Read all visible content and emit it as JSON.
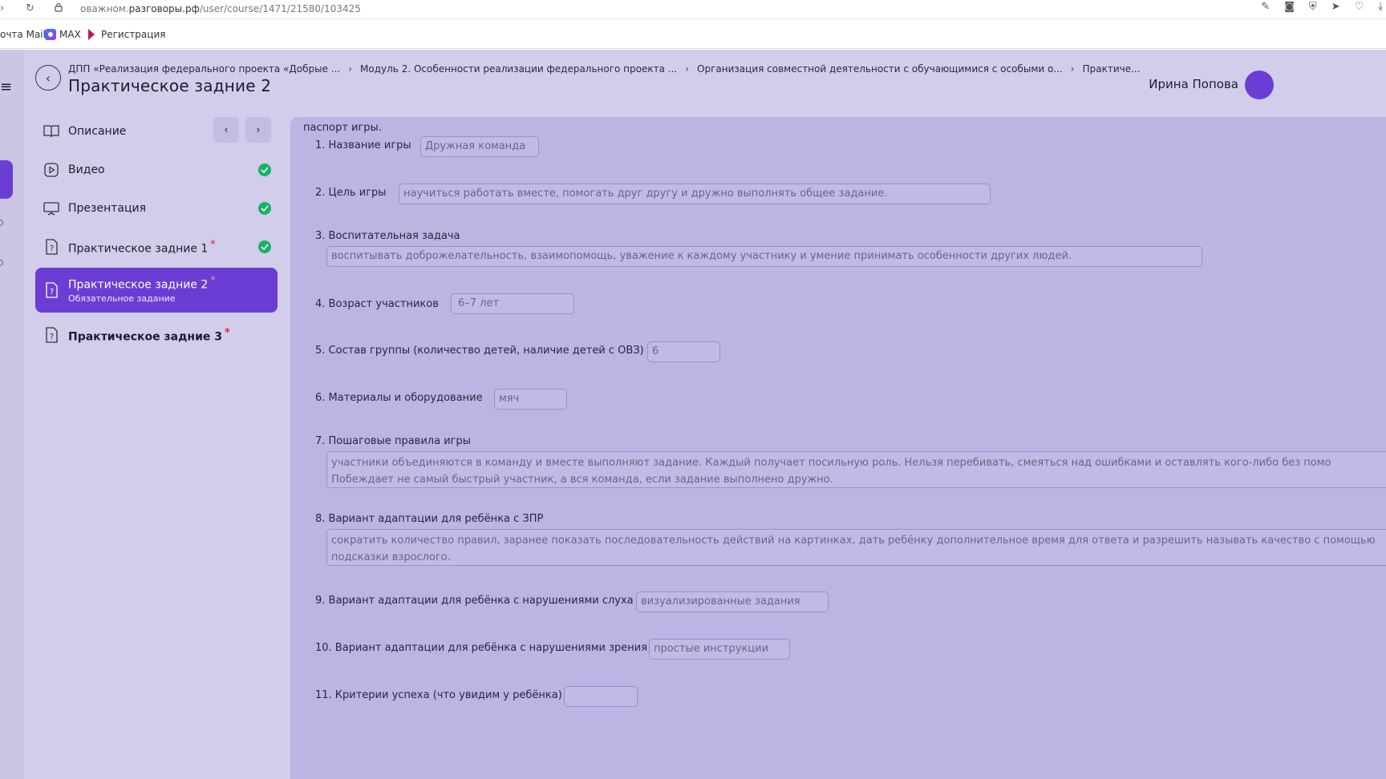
{
  "browser": {
    "url_prefix": "оважном.",
    "url_host": "разговоры.рф",
    "url_path": "/user/course/1471/21580/103425",
    "bookmarks": [
      "очта Mail",
      "MAX",
      "Регистрация"
    ]
  },
  "header": {
    "breadcrumb": [
      "ДПП «Реализация федерального проекта «Добрые ...",
      "Модуль 2. Особенности реализации федерального проекта ...",
      "Организация совместной деятельности с обучающимися с особыми о...",
      "Практиче..."
    ],
    "title": "Практическое задние 2",
    "user_name": "Ирина Попова"
  },
  "sidebar": {
    "items": [
      {
        "label": "Описание",
        "icon": "book-icon",
        "done": false
      },
      {
        "label": "Видео",
        "icon": "play-icon",
        "done": true
      },
      {
        "label": "Презентация",
        "icon": "presentation-icon",
        "done": true
      },
      {
        "label": "Практическое задние 1",
        "icon": "question-icon",
        "done": true,
        "required": "*"
      },
      {
        "label": "Практическое задние 2",
        "icon": "question-icon",
        "required": "*",
        "sub": "Обязательное задание",
        "active": true
      },
      {
        "label": "Практическое задние 3",
        "icon": "question-icon",
        "required": "*"
      }
    ]
  },
  "form": {
    "intro": "паспорт игры.",
    "questions": [
      {
        "label": "1. Название игры",
        "value": "Дружная команда"
      },
      {
        "label": "2. Цель игры",
        "value": "научиться работать вместе, помогать друг другу и дружно выполнять общее задание."
      },
      {
        "label": "3. Воспитательная задача",
        "value": "воспитывать доброжелательность, взаимопомощь, уважение к каждому участнику и умение принимать особенности других людей."
      },
      {
        "label": "4.  Возраст участников",
        "value": "6–7 лет"
      },
      {
        "label": "5. Состав группы (количество детей, наличие детей с ОВЗ)",
        "value": "6"
      },
      {
        "label": "6. Материалы и оборудование",
        "value": "мяч"
      },
      {
        "label": "7. Пошаговые правила игры",
        "value": "участники объединяются в команду и вместе выполняют задание. Каждый получает посильную роль. Нельзя перебивать, смеяться над ошибками и оставлять кого-либо без помо Побеждает не самый быстрый участник, а вся команда, если задание выполнено дружно."
      },
      {
        "label": "8. Вариант адаптации для ребёнка с ЗПР",
        "value": "сократить количество правил, заранее показать последовательность действий на картинках, дать ребёнку дополнительное время для ответа и разрешить называть качество с помощью подсказки взрослого."
      },
      {
        "label": "9. Вариант адаптации для ребёнка с нарушениями слуха",
        "value": "визуализированные задания"
      },
      {
        "label": "10. Вариант адаптации для ребёнка с нарушениями зрения",
        "value": "простые инструкции"
      },
      {
        "label": "11. Критерии успеха (что увидим у ребёнка)",
        "value": ""
      }
    ]
  }
}
